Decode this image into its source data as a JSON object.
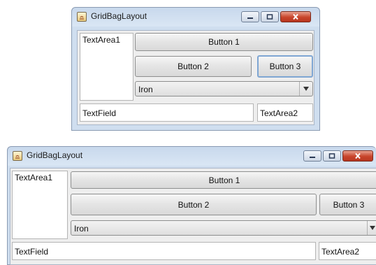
{
  "windows": [
    {
      "title": "GridBagLayout",
      "textarea1": "TextArea1",
      "button1": "Button 1",
      "button2": "Button 2",
      "button3": "Button 3",
      "combo_value": "Iron",
      "textfield": "TextField",
      "textarea2": "TextArea2"
    },
    {
      "title": "GridBagLayout",
      "textarea1": "TextArea1",
      "button1": "Button 1",
      "button2": "Button 2",
      "button3": "Button 3",
      "combo_value": "Iron",
      "textfield": "TextField",
      "textarea2": "TextArea2"
    }
  ],
  "icons": [
    "java-app-icon",
    "minimize-icon",
    "maximize-icon",
    "close-icon",
    "combo-arrow-icon"
  ],
  "colors": {
    "title_bar": "#d9e6f4",
    "client_bg": "#eeeeee",
    "close_button": "#c8442b",
    "focus_border": "#7fa6d3"
  }
}
